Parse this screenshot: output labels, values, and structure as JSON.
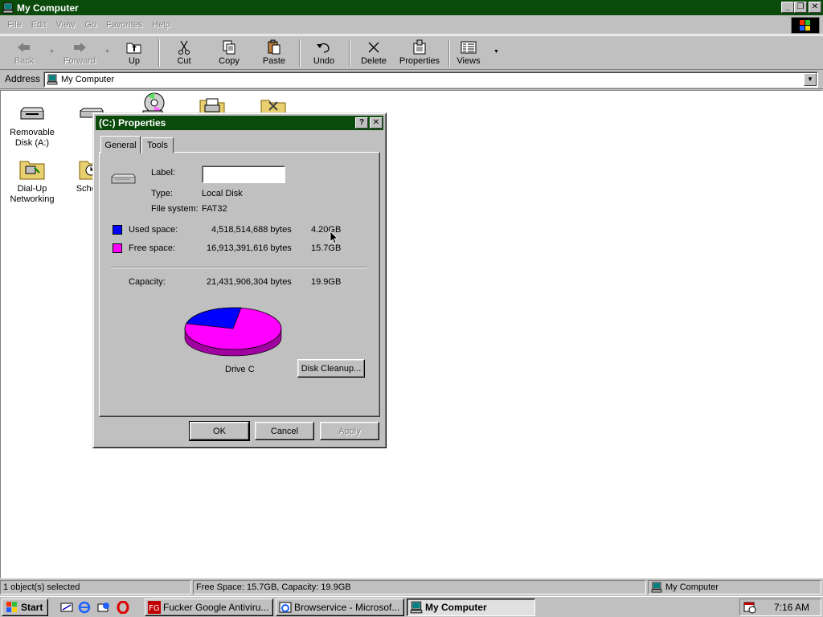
{
  "window": {
    "title": "My Computer",
    "controls": {
      "minimize": "_",
      "maximize": "❐",
      "close": "✕"
    }
  },
  "menu": [
    "File",
    "Edit",
    "View",
    "Go",
    "Favorites",
    "Help"
  ],
  "toolbar": {
    "back": "Back",
    "forward": "Forward",
    "up": "Up",
    "cut": "Cut",
    "copy": "Copy",
    "paste": "Paste",
    "undo": "Undo",
    "delete": "Delete",
    "properties": "Properties",
    "views": "Views"
  },
  "address": {
    "label": "Address",
    "value": "My Computer"
  },
  "desktop_icons": [
    {
      "label": "Removable Disk (A:)",
      "icon": "floppy-drive-icon"
    },
    {
      "label": "(C",
      "icon": "hard-drive-icon"
    },
    {
      "label": "",
      "icon": "cdrom-icon"
    },
    {
      "label": "",
      "icon": "printers-folder-icon"
    },
    {
      "label": "",
      "icon": "control-panel-folder-icon"
    },
    {
      "label": "Dial-Up Networking",
      "icon": "dialup-folder-icon"
    },
    {
      "label": "Schec Tas",
      "icon": "scheduled-tasks-icon"
    }
  ],
  "dialog": {
    "title": "(C:) Properties",
    "help_button": "?",
    "close_button": "✕",
    "tabs": [
      "General",
      "Tools"
    ],
    "active_tab": "General",
    "label_caption": "Label:",
    "label_value": "",
    "type_caption": "Type:",
    "type_value": "Local Disk",
    "fs_caption": "File system:",
    "fs_value": "FAT32",
    "used_caption": "Used space:",
    "used_bytes": "4,518,514,688 bytes",
    "used_size": "4.20GB",
    "free_caption": "Free space:",
    "free_bytes": "16,913,391,616 bytes",
    "free_size": "15.7GB",
    "capacity_caption": "Capacity:",
    "capacity_bytes": "21,431,906,304 bytes",
    "capacity_size": "19.9GB",
    "drive_label": "Drive C",
    "cleanup_button": "Disk Cleanup...",
    "ok_button": "OK",
    "cancel_button": "Cancel",
    "apply_button": "Apply",
    "colors": {
      "used": "#0000ff",
      "free": "#ff00ff"
    },
    "used_fraction": 0.211
  },
  "statusbar": {
    "selection": "1 object(s) selected",
    "space": "Free Space: 15.7GB,  Capacity: 19.9GB",
    "zone": "My Computer"
  },
  "taskbar": {
    "start": "Start",
    "tasks": [
      {
        "label": "Fucker Google Antiviru...",
        "icon": "antivirus-app-icon",
        "active": false
      },
      {
        "label": "Browservice - Microsof...",
        "icon": "ie-window-icon",
        "active": false
      },
      {
        "label": "My Computer",
        "icon": "my-computer-icon",
        "active": true
      }
    ],
    "clock": "7:16 AM"
  }
}
